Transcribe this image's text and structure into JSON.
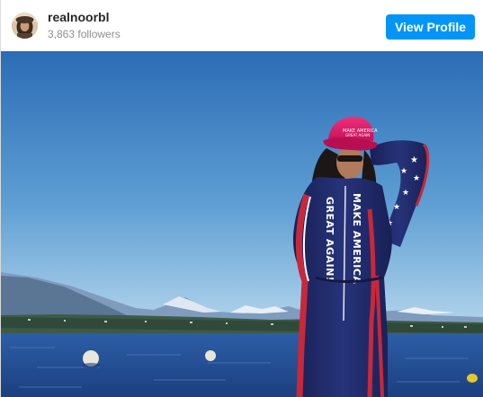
{
  "post": {
    "username": "realnoorbl",
    "followers": "3,863 followers",
    "view_profile_label": "View Profile"
  },
  "photo": {
    "hat_text": "MAKE AMERICA GREAT AGAIN",
    "garment_text": "MAKE AMERICA GREAT AGAIN!"
  },
  "colors": {
    "button": "#0095f6",
    "username": "#262626",
    "followers": "#8e8e8e",
    "sky_top": "#2c6fb8",
    "sky_bottom": "#a9cfe8",
    "water": "#24529a",
    "hat": "#e0226a",
    "suit": "#1f2a6b"
  }
}
